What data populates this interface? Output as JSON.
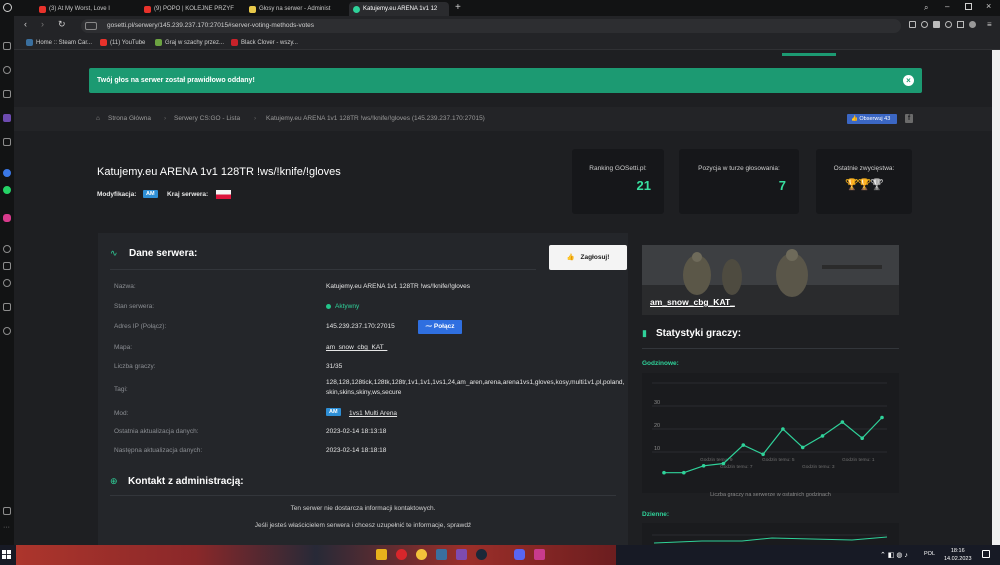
{
  "browser": {
    "tabs": [
      {
        "label": "(3) At My Worst, Love I",
        "color": "#e8322b"
      },
      {
        "label": "(9) POPO | KOLEJNE PRZYF",
        "color": "#e8322b"
      },
      {
        "label": "Głosy na serwer - Administ",
        "color": "#e8c94a"
      },
      {
        "label": "Katujemy.eu ARENA 1v1 12",
        "color": "#2fd29a"
      }
    ],
    "url": "gosetti.pl/serwery/145.239.237.170:27015#server-voting-methods-votes",
    "bookmarks": [
      {
        "label": "Home :: Steam Car..."
      },
      {
        "label": "(11) YouTube"
      },
      {
        "label": "Graj w szachy przez..."
      },
      {
        "label": "Black Clover - wszy..."
      }
    ]
  },
  "toast": {
    "message": "Twój głos na serwer został prawidłowo oddany!",
    "close": "×"
  },
  "breadcrumb": {
    "home": "Strona Główna",
    "list": "Serwery CS:GO - Lista",
    "current": "Katujemy.eu ARENA 1v1 128TR !ws/!knife/!gloves (145.239.237.170:27015)",
    "follow": "Obserwuj 43",
    "fb": "f"
  },
  "server": {
    "title": "Katujemy.eu ARENA 1v1 128TR !ws/!knife/!gloves",
    "mod_label": "Modyfikacja:",
    "mod_badge": "AM",
    "country_label": "Kraj serwera:"
  },
  "stats": {
    "ranking_label": "Ranking GOSetti.pl:",
    "ranking_value": "21",
    "position_label": "Pozycja w turze głosowania:",
    "position_value": "7",
    "winners_label": "Ostatnie zwycięstwa:"
  },
  "details": {
    "title": "Dane serwera:",
    "vote_button": "Zagłosuj!",
    "rows": [
      {
        "label": "Nazwa:",
        "value": "Katujemy.eu ARENA 1v1 128TR !ws/!knife/!gloves"
      },
      {
        "label": "Stan serwera:",
        "value": "Aktywny"
      },
      {
        "label": "Adres IP (Połącz):",
        "value": "145.239.237.170:27015"
      },
      {
        "label": "Mapa:",
        "value": "am_snow_cbg_KAT_"
      },
      {
        "label": "Liczba graczy:",
        "value": "31/35"
      },
      {
        "label": "Tagi:",
        "value": "128,128,128tick,128tk,128tr,1v1,1v1,1vs1,24,am_aren,arena,arena1vs1,gloves,kosy,multi1v1,pl,poland,skin,skins,skiny,ws,secure"
      },
      {
        "label": "Mod:",
        "value": "1vs1 Multi Arena"
      },
      {
        "label": "Ostatnia aktualizacja danych:",
        "value": "2023-02-14 18:13:18"
      },
      {
        "label": "Następna aktualizacja danych:",
        "value": "2023-02-14 18:18:18"
      }
    ],
    "connect_button": "Połącz",
    "mod_badge": "AM"
  },
  "contact": {
    "title": "Kontakt z administracją:",
    "line1": "Ten serwer nie dostarcza informacji kontaktowych.",
    "line2": "Jeśli jesteś właścicielem serwera i chcesz uzupełnić te informacje, sprawdź"
  },
  "side": {
    "map_name": "am_snow_cbg_KAT_",
    "stats_title": "Statystyki graczy:",
    "hourly_label": "Godzinowe:",
    "daily_label": "Dzienne:",
    "caption": "Liczba graczy na serwerze w ostatnich godzinach"
  },
  "chart_data": {
    "type": "line",
    "title": "Godzinowe:",
    "ylim": [
      0,
      40
    ],
    "yticks": [
      "10",
      "20",
      "30"
    ],
    "x_labels": [
      "Godzin temu: 9",
      "Godzin temu: 7",
      "Godzin temu: 5",
      "Godzin temu: 3",
      "Godzin temu: 1"
    ],
    "values": [
      1,
      1,
      4,
      5,
      13,
      9,
      20,
      12,
      17,
      23,
      16,
      25
    ],
    "color": "#2fd29a"
  },
  "taskbar": {
    "lang": "POL",
    "time": "18:16",
    "date": "14.02.2023"
  }
}
